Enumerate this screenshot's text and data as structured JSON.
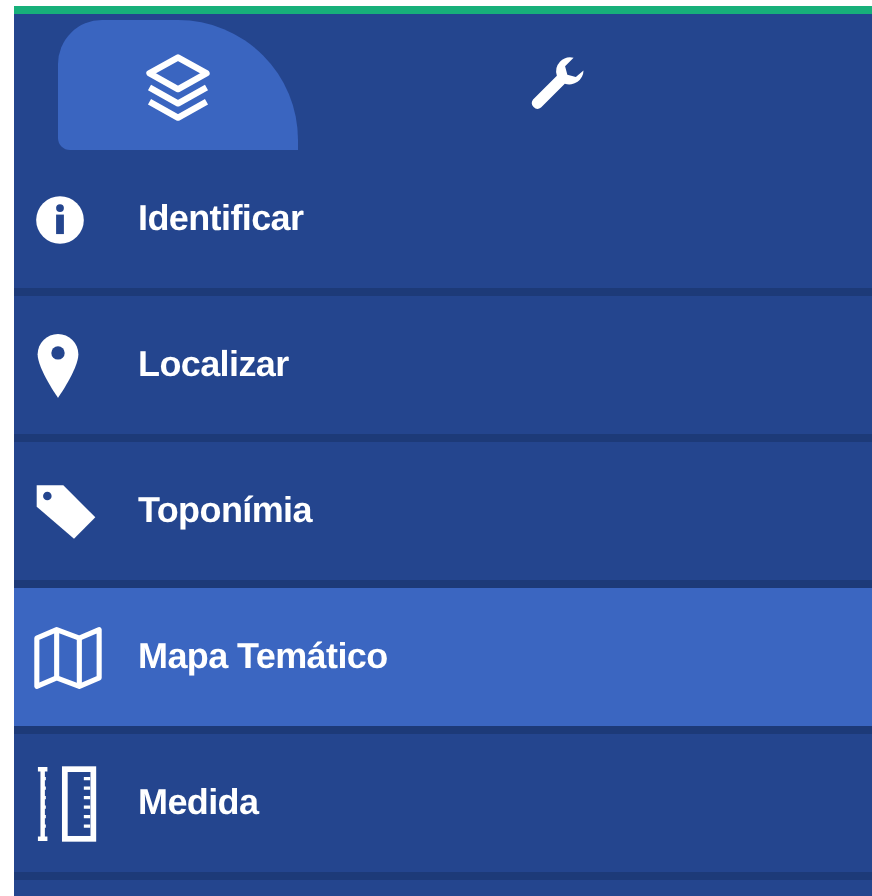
{
  "tabs": [
    {
      "kind": "layers",
      "selected": true
    },
    {
      "kind": "tools",
      "selected": false
    }
  ],
  "menu": [
    {
      "kind": "info",
      "label": "Identificar",
      "selected": false
    },
    {
      "kind": "pin",
      "label": "Localizar",
      "selected": false
    },
    {
      "kind": "tag",
      "label": "Toponímia",
      "selected": false
    },
    {
      "kind": "map",
      "label": "Mapa Temático",
      "selected": true
    },
    {
      "kind": "ruler",
      "label": "Medida",
      "selected": false
    }
  ]
}
